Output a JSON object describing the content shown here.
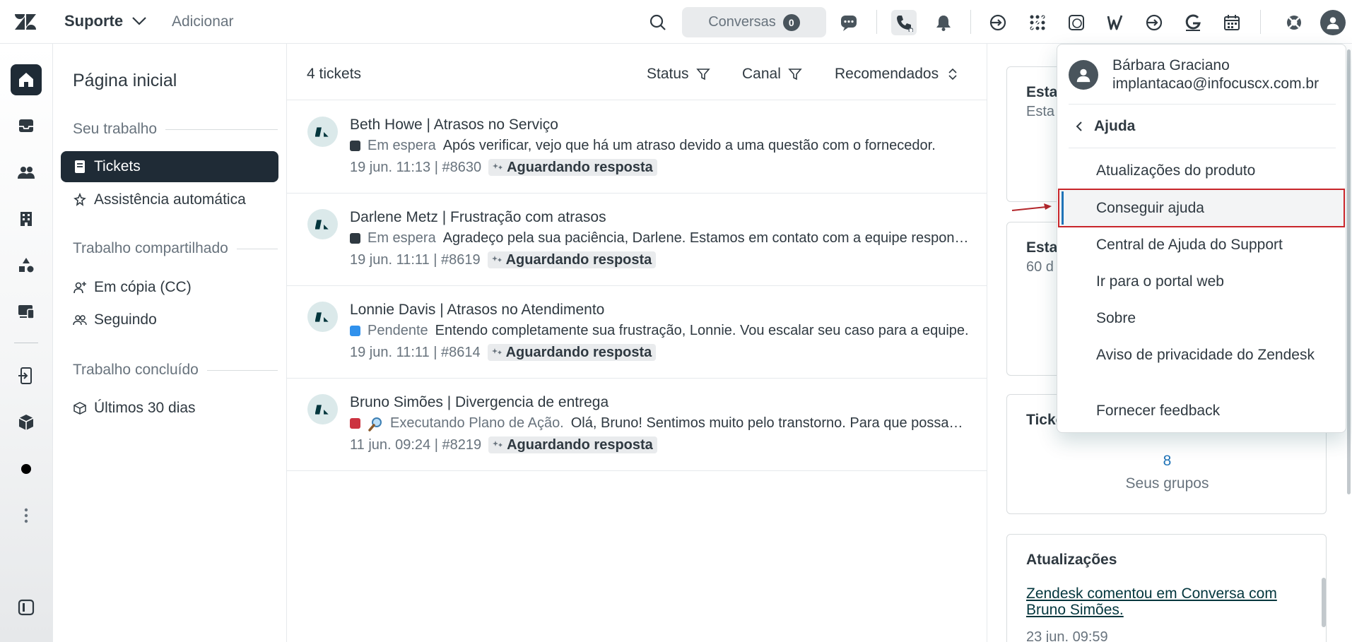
{
  "topbar": {
    "product": "Suporte",
    "add": "Adicionar",
    "conversations_label": "Conversas",
    "conversations_count": "0"
  },
  "nav": {
    "title": "Página inicial",
    "sections": {
      "your_work": "Seu trabalho",
      "shared": "Trabalho compartilhado",
      "done": "Trabalho concluído"
    },
    "items": {
      "tickets": "Tickets",
      "auto": "Assistência automática",
      "cc": "Em cópia (CC)",
      "following": "Seguindo",
      "last30": "Últimos 30 dias"
    }
  },
  "list": {
    "count": "4 tickets",
    "filters": {
      "status": "Status",
      "channel": "Canal",
      "sort": "Recomendados"
    },
    "tickets": [
      {
        "title": "Beth Howe | Atrasos no Serviço",
        "status": "Em espera",
        "status_color": "#2f3941",
        "preview": "Após verificar, vejo que há um atraso devido a uma questão com o fornecedor.",
        "meta": "19 jun. 11:13 | #8630",
        "tag": "Aguardando resposta"
      },
      {
        "title": "Darlene Metz | Frustração com atrasos",
        "status": "Em espera",
        "status_color": "#2f3941",
        "preview": "Agradeço pela sua paciência, Darlene. Estamos em contato com a equipe responsável.",
        "meta": "19 jun. 11:11 | #8619",
        "tag": "Aguardando resposta"
      },
      {
        "title": "Lonnie Davis | Atrasos no Atendimento",
        "status": "Pendente",
        "status_color": "#3091ec",
        "preview": "Entendo completamente sua frustração, Lonnie. Vou escalar seu caso para a equipe.",
        "meta": "19 jun. 11:11 | #8614",
        "tag": "Aguardando resposta"
      },
      {
        "title": "Bruno Simões | Divergencia de entrega",
        "status": "Executando Plano de Ação.",
        "status_color": "#cc3340",
        "preview": "Olá, Bruno! Sentimos muito pelo transtorno. Para que possamos resolver rapidamente.",
        "meta": "11 jun. 09:24 | #8219",
        "tag": "Aguardando resposta"
      }
    ]
  },
  "right": {
    "card1": {
      "title": "Esta",
      "sub": "Esta"
    },
    "card2": {
      "title": "Esta",
      "sub": "60 d"
    },
    "card3": {
      "title": "Ticke",
      "number": "8",
      "label": "Seus grupos"
    },
    "updates": {
      "title": "Atualizações",
      "link": "Zendesk comentou em Conversa com Bruno Simões.",
      "date": "23 jun. 09:59"
    }
  },
  "menu": {
    "user_name": "Bárbara Graciano",
    "user_email": "implantacao@infocuscx.com.br",
    "back_label": "Ajuda",
    "items": [
      "Atualizações do produto",
      "Conseguir ajuda",
      "Central de Ajuda do Support",
      "Ir para o portal web",
      "Sobre",
      "Aviso de privacidade do Zendesk",
      "Fornecer feedback"
    ]
  },
  "colors": {
    "dark": "#1f2b36",
    "accent": "#1f73b7",
    "highlight_border": "#c8252a"
  }
}
